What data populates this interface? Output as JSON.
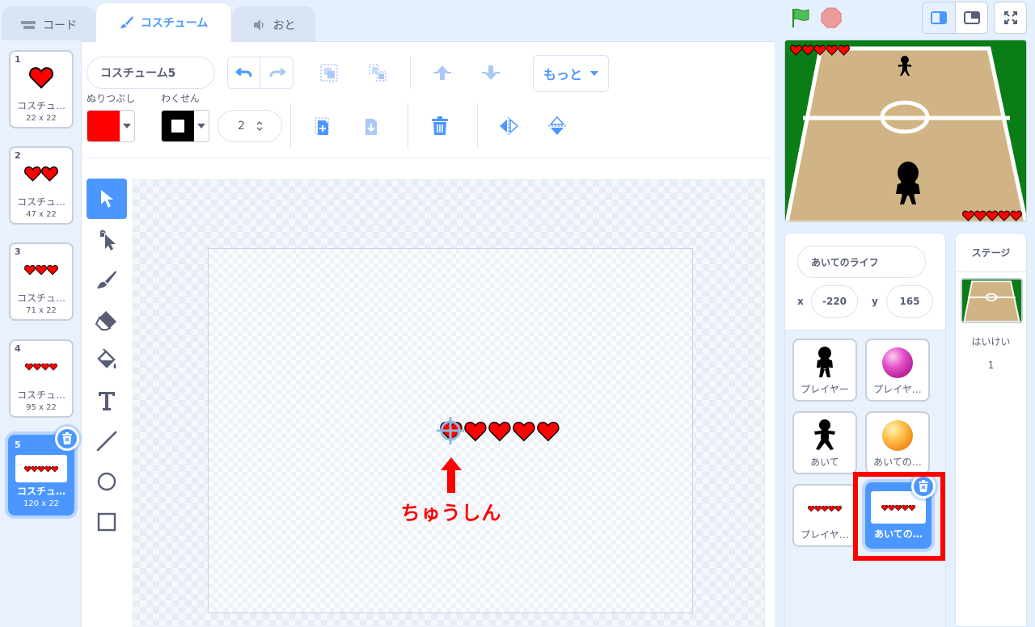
{
  "tabs": {
    "code": "コード",
    "costumes": "コスチューム",
    "sounds": "おと"
  },
  "costumes": [
    {
      "num": "1",
      "name": "コスチュ…",
      "size": "22 x 22",
      "hearts": 1
    },
    {
      "num": "2",
      "name": "コスチュ…",
      "size": "47 x 22",
      "hearts": 2
    },
    {
      "num": "3",
      "name": "コスチュ…",
      "size": "71 x 22",
      "hearts": 3
    },
    {
      "num": "4",
      "name": "コスチュ…",
      "size": "95 x 22",
      "hearts": 4
    },
    {
      "num": "5",
      "name": "コスチュ…",
      "size": "120 x 22",
      "hearts": 5
    }
  ],
  "selected_costume": 5,
  "editor": {
    "costume_name": "コスチューム5",
    "more_label": "もっと",
    "fill_label": "ぬりつぶし",
    "outline_label": "わくせん",
    "outline_width": "2",
    "fill_color": "#ff0000",
    "outline_color": "#000000"
  },
  "annotation": {
    "center_label": "ちゅうしん",
    "highlight_color": "#ff0000"
  },
  "stage_controls": {
    "green_flag": "green-flag-icon",
    "stop": "stop-icon"
  },
  "stage_lives": {
    "top_hearts": 5,
    "bottom_hearts": 5
  },
  "sprite_info": {
    "name": "あいてのライフ",
    "x_label": "x",
    "x_value": "-220",
    "y_label": "y",
    "y_value": "165"
  },
  "sprites": [
    {
      "name": "プレイヤー",
      "icon": "player-figure"
    },
    {
      "name": "プレイヤ…",
      "icon": "pink-ball"
    },
    {
      "name": "あいて",
      "icon": "opponent-figure"
    },
    {
      "name": "あいての…",
      "icon": "orange-ball"
    },
    {
      "name": "プレイヤ…",
      "icon": "hearts"
    },
    {
      "name": "あいての…",
      "icon": "hearts"
    }
  ],
  "stage_pane": {
    "title": "ステージ",
    "backdrop_label": "はいけい",
    "backdrop_count": "1"
  },
  "colors": {
    "accent": "#4c97ff",
    "background": "#e5f0ff",
    "heart": "#ff0000"
  }
}
